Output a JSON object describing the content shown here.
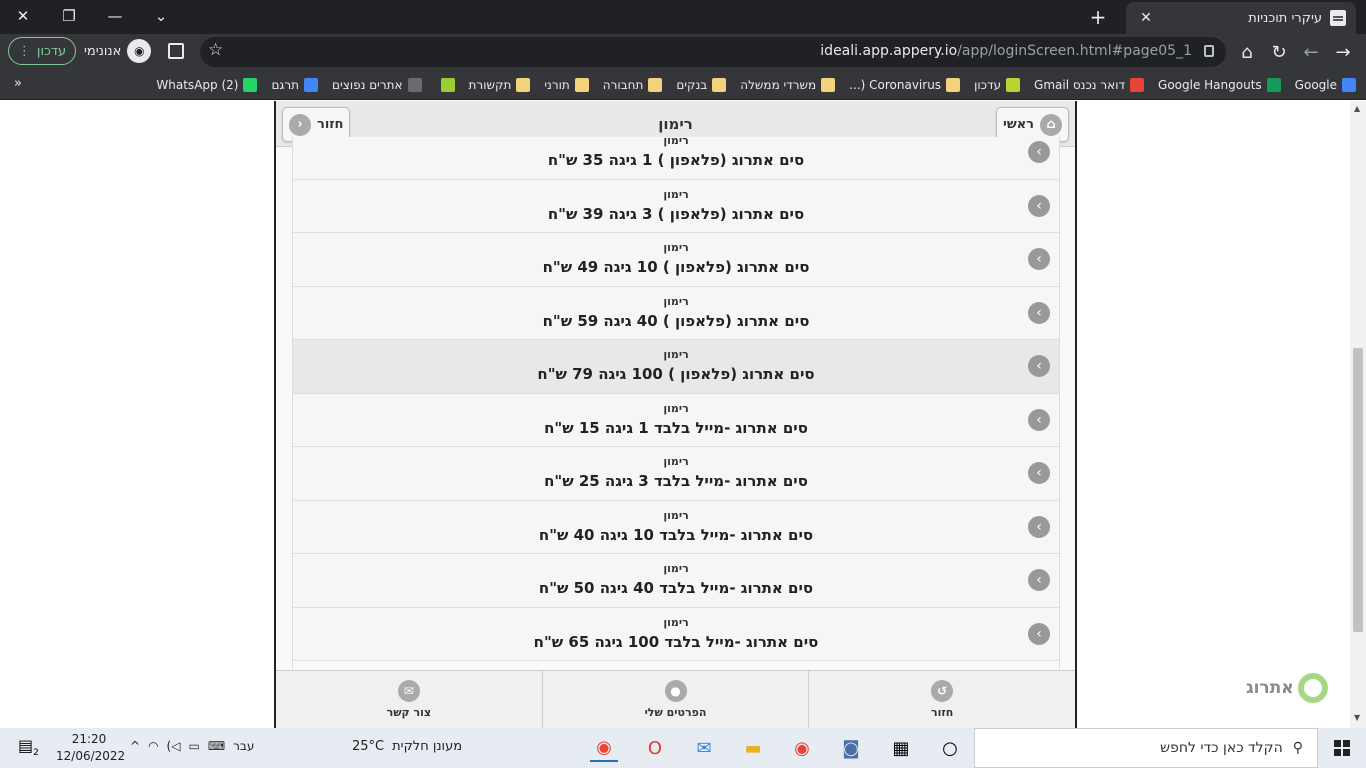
{
  "browser": {
    "tab_title": "עיקרי תוכניות",
    "url_host": "ideali.app.appery.io",
    "url_path": "/app/loginScreen.html#page05_1",
    "update_label": "עדכון",
    "incognito_label": "אנונימי"
  },
  "bookmarks": [
    {
      "label": "Google",
      "color": "#4285f4"
    },
    {
      "label": "Google Hangouts",
      "color": "#0f9d58"
    },
    {
      "label": "דואר נכנס Gmail",
      "color": "#ea4335"
    },
    {
      "label": "עדכון",
      "color": "#b8d432"
    },
    {
      "label": "Coronavirus (...",
      "color": "#f2d27a"
    },
    {
      "label": "משרדי ממשלה",
      "color": "#f2d27a"
    },
    {
      "label": "בנקים",
      "color": "#f2d27a"
    },
    {
      "label": "תחבורה",
      "color": "#f2d27a"
    },
    {
      "label": "תורני",
      "color": "#f2d27a"
    },
    {
      "label": "תקשורת",
      "color": "#f2d27a"
    },
    {
      "label": "",
      "color": "#9acd32"
    },
    {
      "label": "אתרים נפוצים",
      "color": "#6b6b6b"
    },
    {
      "label": "תרגם",
      "color": "#4285f4"
    },
    {
      "label": "(2) WhatsApp",
      "color": "#25d366"
    }
  ],
  "header": {
    "title": "רימון",
    "home_label": "ראשי",
    "back_label": "חזור"
  },
  "plans": [
    {
      "brand": "רימון",
      "name": "סים אתרוג (פלאפון ) 1 גיגה 35 ש\"ח"
    },
    {
      "brand": "רימון",
      "name": "סים אתרוג (פלאפון ) 3 גיגה 39 ש\"ח"
    },
    {
      "brand": "רימון",
      "name": "סים אתרוג (פלאפון ) 10 גיגה 49 ש\"ח"
    },
    {
      "brand": "רימון",
      "name": "סים אתרוג (פלאפון ) 40 גיגה 59 ש\"ח"
    },
    {
      "brand": "רימון",
      "name": "סים אתרוג (פלאפון ) 100 גיגה 79 ש\"ח"
    },
    {
      "brand": "רימון",
      "name": "סים אתרוג -מייל בלבד 1 גיגה 15 ש\"ח"
    },
    {
      "brand": "רימון",
      "name": "סים אתרוג -מייל בלבד 3 גיגה 25 ש\"ח"
    },
    {
      "brand": "רימון",
      "name": "סים אתרוג -מייל בלבד 10 גיגה 40 ש\"ח"
    },
    {
      "brand": "רימון",
      "name": "סים אתרוג -מייל בלבד 40 גיגה 50 ש\"ח"
    },
    {
      "brand": "רימון",
      "name": "סים אתרוג -מייל בלבד 100 גיגה 65 ש\"ח"
    }
  ],
  "footer": {
    "back_label": "חזור",
    "details_label": "הפרטים שלי",
    "contact_label": "צור קשר"
  },
  "logo_text": "אתרוג",
  "taskbar": {
    "search_placeholder": "הקלד כאן כדי לחפש",
    "weather_temp": "25°C",
    "weather_desc": "מעונן חלקית",
    "language": "עבר",
    "time": "21:20",
    "date": "12/06/2022",
    "notifications": "2"
  }
}
